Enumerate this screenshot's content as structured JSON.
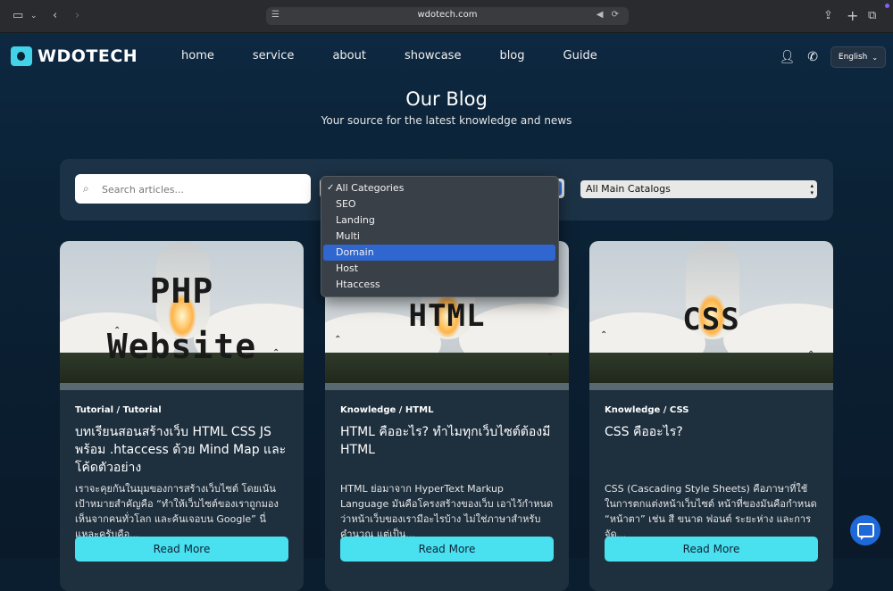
{
  "browser": {
    "url": "wdotech.com"
  },
  "nav": {
    "logo": "WDOTECH",
    "links": [
      "home",
      "service",
      "about",
      "showcase",
      "blog",
      "Guide"
    ],
    "language": "English"
  },
  "hero": {
    "title": "Our Blog",
    "subtitle": "Your source for the latest knowledge and news"
  },
  "filters": {
    "search_placeholder": "Search articles...",
    "category_options": [
      "All Categories",
      "SEO",
      "Landing",
      "Multi",
      "Domain",
      "Host",
      "Htaccess"
    ],
    "category_selected": "All Categories",
    "category_highlighted": "Domain",
    "main_catalog": "All Main Catalogs"
  },
  "cards": [
    {
      "image_text": [
        "PHP",
        "Website"
      ],
      "category": "Tutorial",
      "subcategory": "Tutorial",
      "title": "บทเรียนสอนสร้างเว็บ HTML CSS JS พร้อม .htaccess ด้วย Mind Map และโค้ดตัวอย่าง",
      "description": "เราจะคุยกันในมุมของการสร้างเว็บไซต์ โดยเน้นเป้าหมายสำคัญคือ “ทำให้เว็บไซต์ของเราถูกมองเห็นจากคนทั่วโลก และค้นเจอบน Google” นี่แหละครับคือ...",
      "button": "Read More"
    },
    {
      "image_text": [
        "HTML"
      ],
      "category": "Knowledge",
      "subcategory": "HTML",
      "title": "HTML คืออะไร? ทำไมทุกเว็บไซต์ต้องมี HTML",
      "description": "HTML ย่อมาจาก HyperText Markup Language มันคือโครงสร้างของเว็บ เอาไว้กำหนดว่าหน้าเว็บของเรามีอะไรบ้าง ไม่ใช่ภาษาสำหรับคำนวณ แต่เป็น...",
      "button": "Read More"
    },
    {
      "image_text": [
        "CSS"
      ],
      "category": "Knowledge",
      "subcategory": "CSS",
      "title": "CSS คืออะไร?",
      "description": "CSS (Cascading Style Sheets) คือภาษาที่ใช้ในการตกแต่งหน้าเว็บไซต์ หน้าที่ของมันคือกำหนด “หน้าตา” เช่น สี ขนาด ฟอนต์ ระยะห่าง และการจัด...",
      "button": "Read More"
    }
  ],
  "colors": {
    "accent": "#49e0f0",
    "highlight": "#2f66cf",
    "chat": "#1f68d8"
  }
}
